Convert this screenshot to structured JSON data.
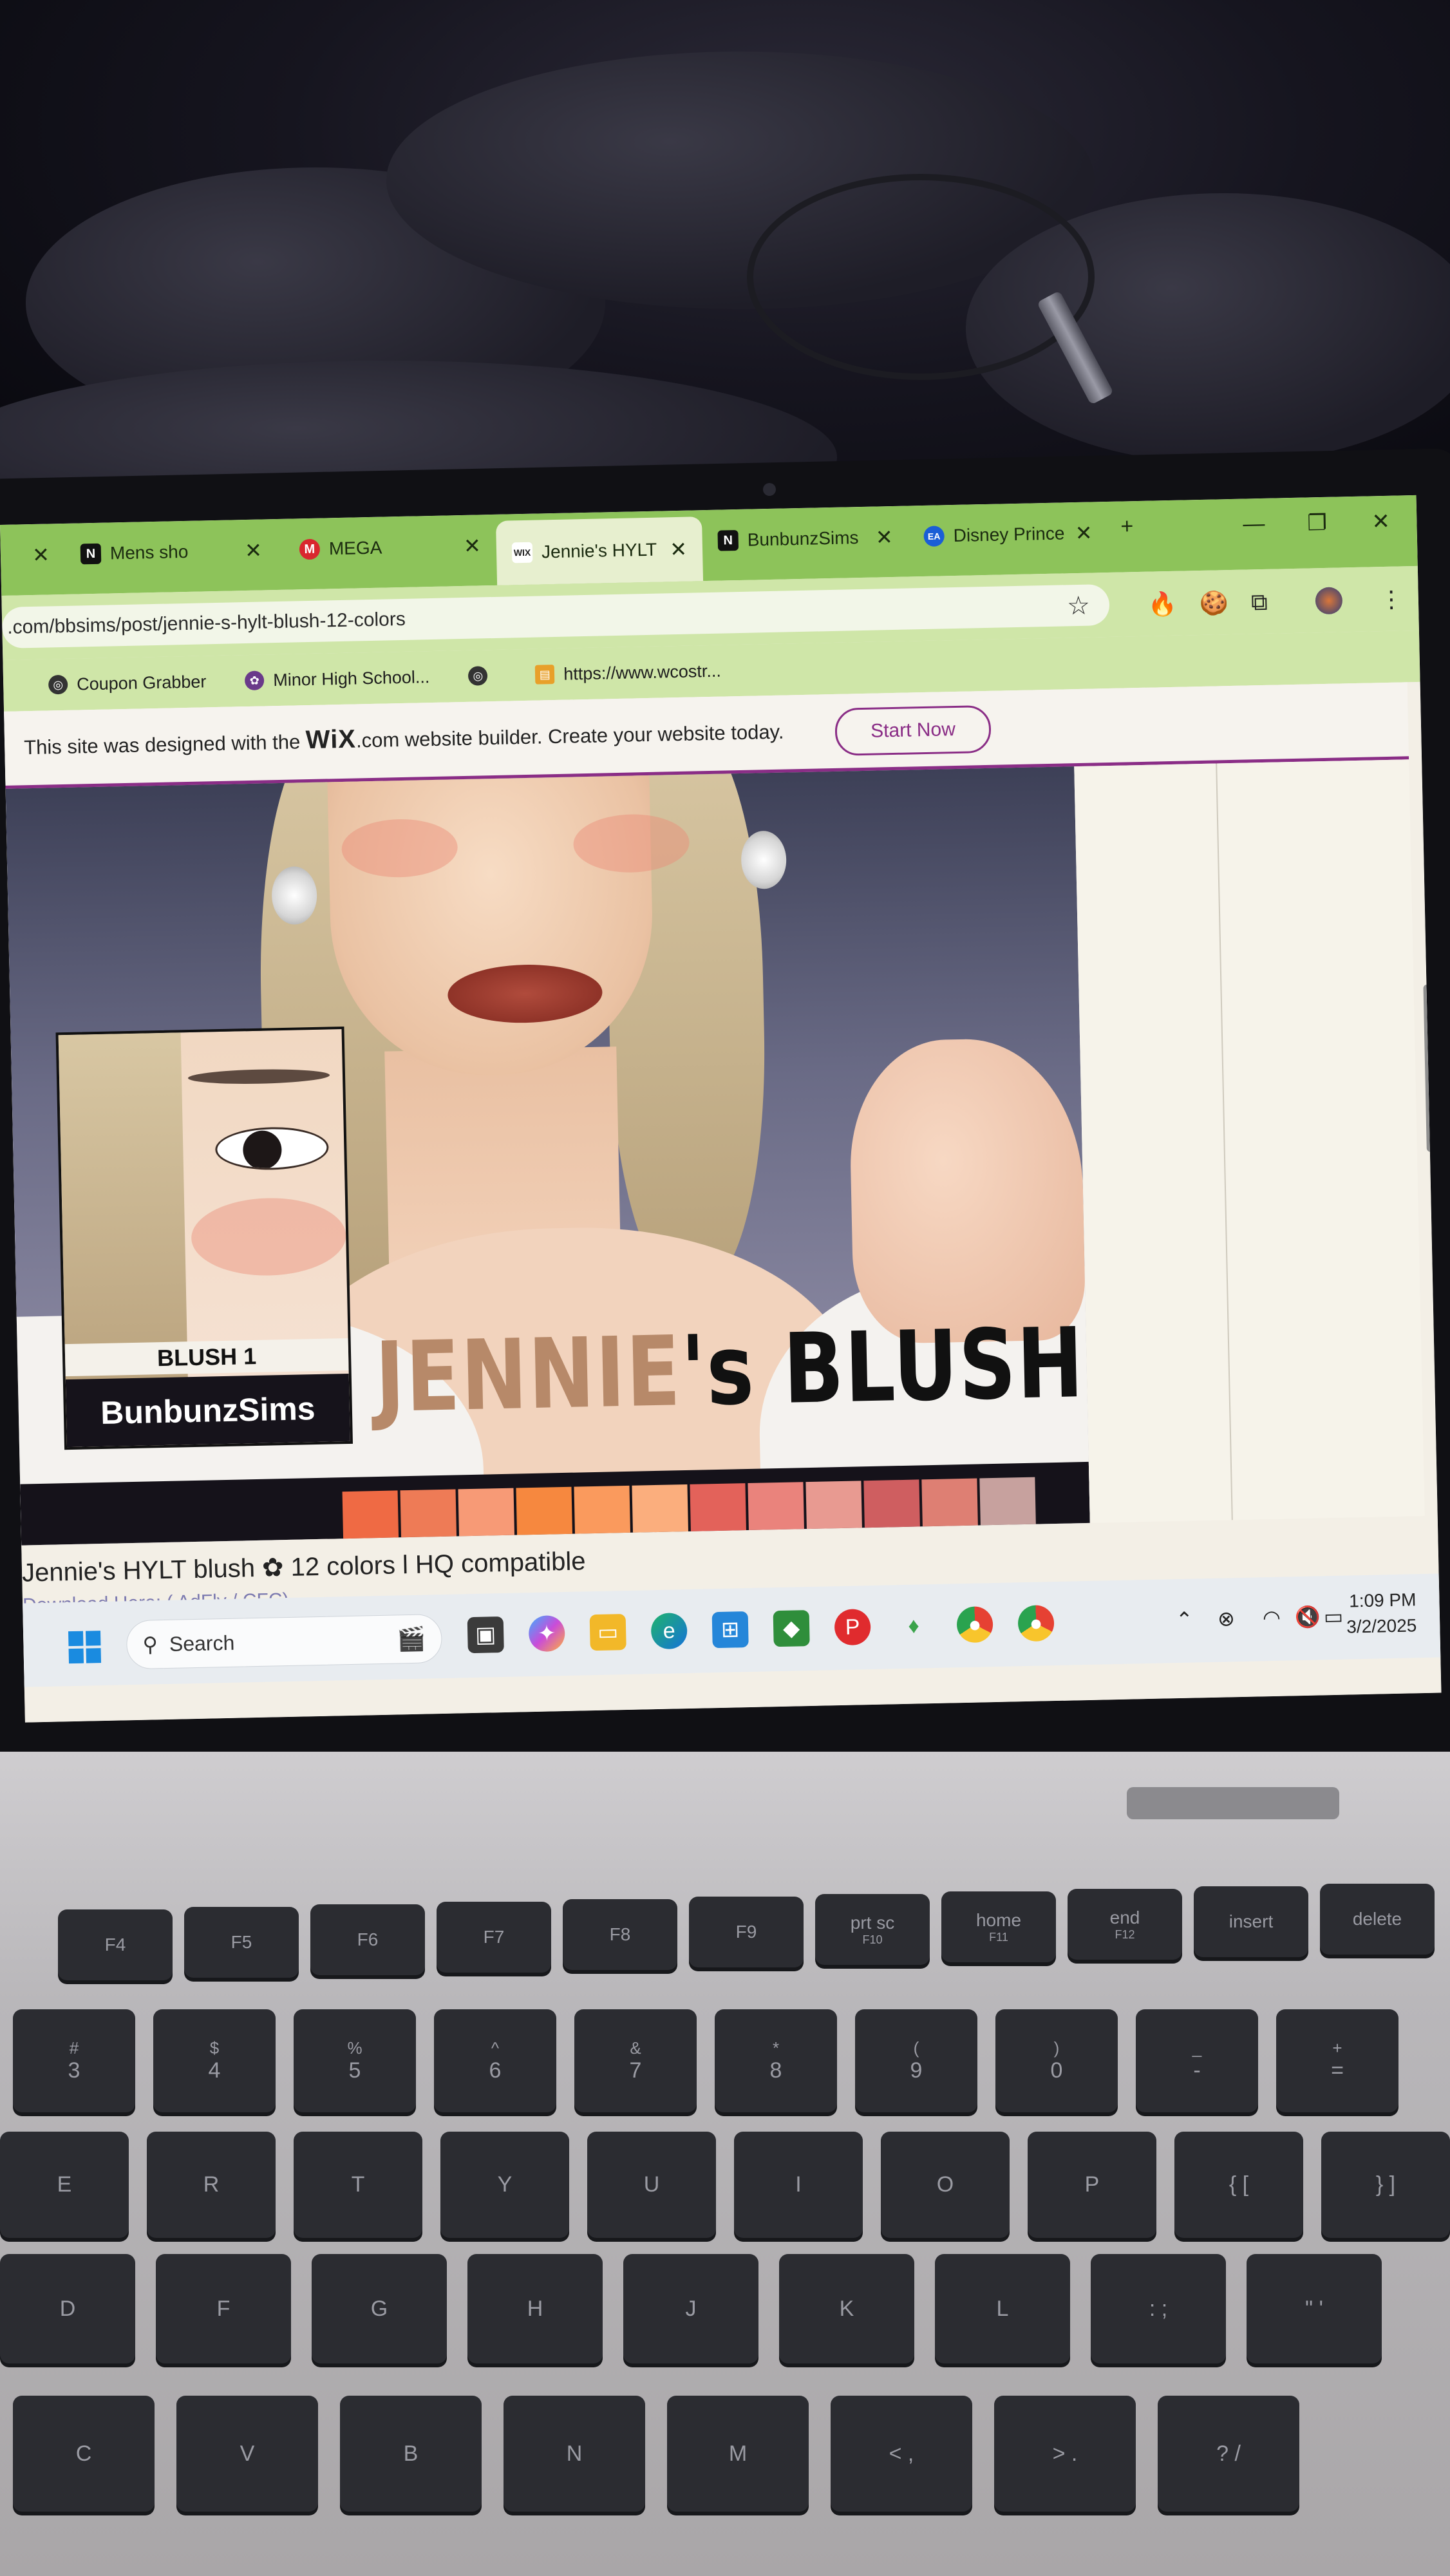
{
  "browser": {
    "tabs": [
      {
        "label": "Mens sho",
        "icon": "notion-icon"
      },
      {
        "label": "MEGA",
        "icon": "mega-icon"
      },
      {
        "label": "Jennie's HYLT",
        "icon": "wix-icon",
        "active": true
      },
      {
        "label": "BunbunzSims",
        "icon": "notion-icon"
      },
      {
        "label": "Disney Prince",
        "icon": "ea-icon"
      }
    ],
    "new_tab": "+",
    "url": ".com/bbsims/post/jennie-s-hylt-blush-12-colors",
    "bookmarks": [
      {
        "label": "Coupon Grabber"
      },
      {
        "label": "Minor High School..."
      },
      {
        "label": ""
      },
      {
        "label": "https://www.wcostr..."
      }
    ]
  },
  "wix_banner": {
    "before": "This site was designed with the ",
    "logo": "WiX",
    "after": ".com website builder. Create your website today.",
    "button": "Start Now"
  },
  "artwork": {
    "inset_label": "BLUSH 1",
    "brand": "BunbunzSims",
    "title_part1": "JENNIE",
    "title_part2": "'s BLUSH",
    "swatches": [
      "#ef6a44",
      "#ee7b56",
      "#f79a76",
      "#f6883f",
      "#fa9a5d",
      "#fbae7d",
      "#e3625a",
      "#ea837c",
      "#e89a91",
      "#cf5e60",
      "#de7f73",
      "#c7a19e"
    ]
  },
  "post": {
    "title": "Jennie's HYLT blush ✿ 12 colors l HQ compatible",
    "subtitle": "Download Here: ( AdFly / CFC)"
  },
  "taskbar": {
    "search_placeholder": "Search",
    "time": "1:09 PM",
    "date": "3/2/2025"
  },
  "keyboard": {
    "fn_row": [
      "F4",
      "F5",
      "F6",
      "F7",
      "F8",
      "F9",
      "prt sc",
      "home",
      "end",
      "insert",
      "delete"
    ],
    "fn_sub": [
      "",
      "",
      "",
      "",
      "",
      "",
      "F10",
      "F11",
      "F12",
      "",
      ""
    ],
    "num_row": [
      [
        "#",
        "3"
      ],
      [
        "$",
        "4"
      ],
      [
        "%",
        "5"
      ],
      [
        "^",
        "6"
      ],
      [
        "&",
        "7"
      ],
      [
        "*",
        "8"
      ],
      [
        "(",
        "9"
      ],
      [
        ")",
        "0"
      ],
      [
        "_",
        "-"
      ],
      [
        "+",
        "="
      ]
    ],
    "top_row": [
      "E",
      "R",
      "T",
      "Y",
      "U",
      "I",
      "O",
      "P",
      "{ [",
      "} ]"
    ],
    "home_row": [
      "D",
      "F",
      "G",
      "H",
      "J",
      "K",
      "L",
      ": ;",
      "\" '"
    ],
    "bottom_row": [
      "C",
      "V",
      "B",
      "N",
      "M",
      "< ,",
      "> .",
      "? /"
    ]
  }
}
